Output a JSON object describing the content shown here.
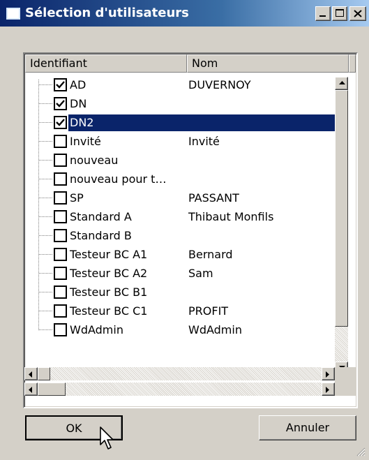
{
  "window": {
    "title": "Sélection d'utilisateurs"
  },
  "columns": {
    "identifiant": "Identifiant",
    "nom": "Nom"
  },
  "rows": [
    {
      "id": "AD",
      "nom": "DUVERNOY",
      "checked": true
    },
    {
      "id": "DN",
      "nom": "",
      "checked": true
    },
    {
      "id": "DN2",
      "nom": "",
      "checked": true,
      "selected": true
    },
    {
      "id": "Invité",
      "nom": "Invité",
      "checked": false
    },
    {
      "id": "nouveau",
      "nom": "",
      "checked": false
    },
    {
      "id": "nouveau pour t…",
      "nom": "",
      "checked": false
    },
    {
      "id": "SP",
      "nom": "PASSANT",
      "checked": false
    },
    {
      "id": "Standard A",
      "nom": "Thibaut Monfils",
      "checked": false
    },
    {
      "id": "Standard B",
      "nom": "",
      "checked": false
    },
    {
      "id": "Testeur BC A1",
      "nom": "Bernard",
      "checked": false
    },
    {
      "id": "Testeur BC A2",
      "nom": "Sam",
      "checked": false
    },
    {
      "id": "Testeur BC B1",
      "nom": "",
      "checked": false
    },
    {
      "id": "Testeur BC C1",
      "nom": "PROFIT",
      "checked": false
    },
    {
      "id": "WdAdmin",
      "nom": "WdAdmin",
      "checked": false
    }
  ],
  "buttons": {
    "ok": "OK",
    "cancel": "Annuler"
  },
  "colors": {
    "selection": "#0a246a",
    "face": "#d4d0c8"
  }
}
